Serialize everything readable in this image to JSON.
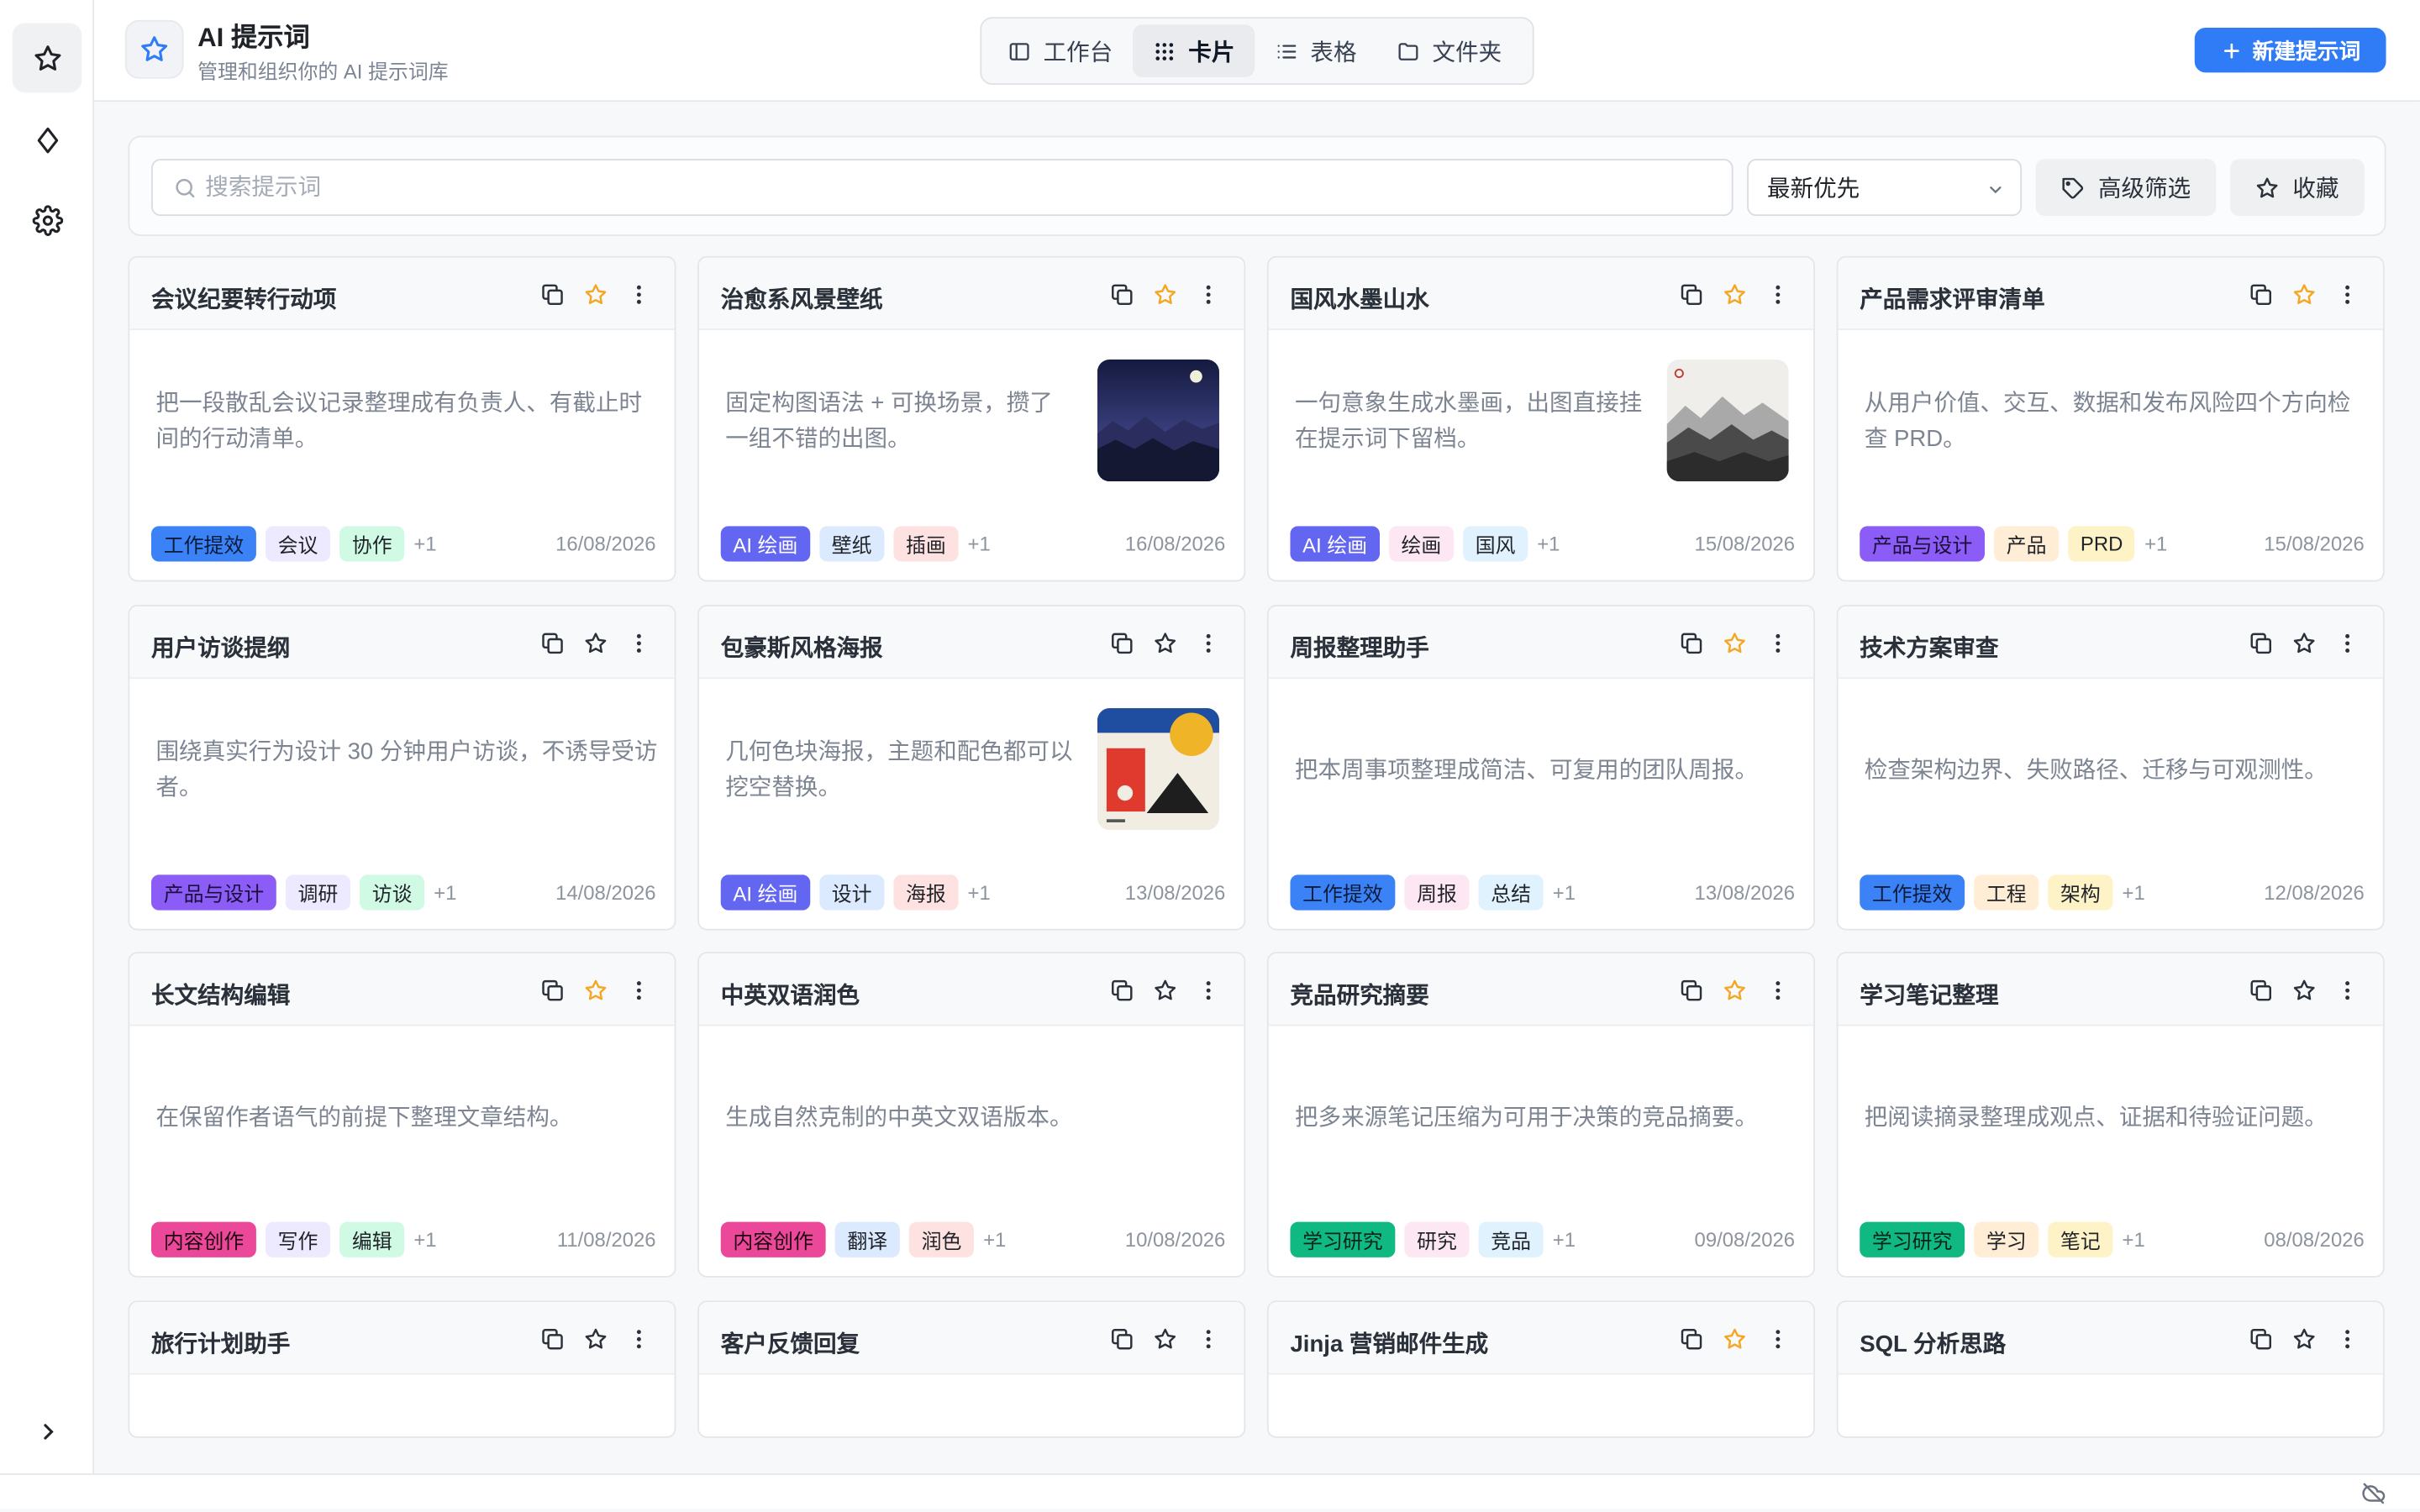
{
  "header": {
    "title": "AI 提示词",
    "subtitle": "管理和组织你的 AI 提示词库",
    "views": [
      "工作台",
      "卡片",
      "表格",
      "文件夹"
    ],
    "active_view": "卡片",
    "new_button": "新建提示词"
  },
  "filters": {
    "search_placeholder": "搜索提示词",
    "sort": "最新优先",
    "advanced": "高级筛选",
    "favorites": "收藏"
  },
  "colors": {
    "accent": "#2f7cf6",
    "star_active": "#f5a623"
  },
  "cards": [
    {
      "title": "会议纪要转行动项",
      "desc": "把一段散乱会议记录整理成有负责人、有截止时间的行动清单。",
      "starred": true,
      "image": "",
      "tags": [
        "工作提效",
        "会议",
        "协作"
      ],
      "more": "+1",
      "date": "16/08/2026"
    },
    {
      "title": "治愈系风景壁纸",
      "desc": "固定构图语法 + 可换场景，攒了一组不错的出图。",
      "starred": true,
      "image": "night-landscape",
      "tags": [
        "AI 绘画",
        "壁纸",
        "插画"
      ],
      "more": "+1",
      "date": "16/08/2026"
    },
    {
      "title": "国风水墨山水",
      "desc": "一句意象生成水墨画，出图直接挂在提示词下留档。",
      "starred": true,
      "image": "ink-mountains",
      "tags": [
        "AI 绘画",
        "绘画",
        "国风"
      ],
      "more": "+1",
      "date": "15/08/2026"
    },
    {
      "title": "产品需求评审清单",
      "desc": "从用户价值、交互、数据和发布风险四个方向检查 PRD。",
      "starred": true,
      "image": "",
      "tags": [
        "产品与设计",
        "产品",
        "PRD"
      ],
      "more": "+1",
      "date": "15/08/2026"
    },
    {
      "title": "用户访谈提纲",
      "desc": "围绕真实行为设计 30 分钟用户访谈，不诱导受访者。",
      "starred": false,
      "image": "",
      "tags": [
        "产品与设计",
        "调研",
        "访谈"
      ],
      "more": "+1",
      "date": "14/08/2026"
    },
    {
      "title": "包豪斯风格海报",
      "desc": "几何色块海报，主题和配色都可以挖空替换。",
      "starred": false,
      "image": "bauhaus-poster",
      "tags": [
        "AI 绘画",
        "设计",
        "海报"
      ],
      "more": "+1",
      "date": "13/08/2026"
    },
    {
      "title": "周报整理助手",
      "desc": "把本周事项整理成简洁、可复用的团队周报。",
      "starred": true,
      "image": "",
      "tags": [
        "工作提效",
        "周报",
        "总结"
      ],
      "more": "+1",
      "date": "13/08/2026"
    },
    {
      "title": "技术方案审查",
      "desc": "检查架构边界、失败路径、迁移与可观测性。",
      "starred": false,
      "image": "",
      "tags": [
        "工作提效",
        "工程",
        "架构"
      ],
      "more": "+1",
      "date": "12/08/2026"
    },
    {
      "title": "长文结构编辑",
      "desc": "在保留作者语气的前提下整理文章结构。",
      "starred": true,
      "image": "",
      "tags": [
        "内容创作",
        "写作",
        "编辑"
      ],
      "more": "+1",
      "date": "11/08/2026"
    },
    {
      "title": "中英双语润色",
      "desc": "生成自然克制的中英文双语版本。",
      "starred": false,
      "image": "",
      "tags": [
        "内容创作",
        "翻译",
        "润色"
      ],
      "more": "+1",
      "date": "10/08/2026"
    },
    {
      "title": "竞品研究摘要",
      "desc": "把多来源笔记压缩为可用于决策的竞品摘要。",
      "starred": true,
      "image": "",
      "tags": [
        "学习研究",
        "研究",
        "竞品"
      ],
      "more": "+1",
      "date": "09/08/2026"
    },
    {
      "title": "学习笔记整理",
      "desc": "把阅读摘录整理成观点、证据和待验证问题。",
      "starred": false,
      "image": "",
      "tags": [
        "学习研究",
        "学习",
        "笔记"
      ],
      "more": "+1",
      "date": "08/08/2026"
    },
    {
      "title": "旅行计划助手",
      "desc": "",
      "starred": false,
      "image": "",
      "tags": [],
      "more": "",
      "date": ""
    },
    {
      "title": "客户反馈回复",
      "desc": "",
      "starred": false,
      "image": "",
      "tags": [],
      "more": "",
      "date": ""
    },
    {
      "title": "Jinja 营销邮件生成",
      "desc": "",
      "starred": true,
      "image": "",
      "tags": [],
      "more": "",
      "date": ""
    },
    {
      "title": "SQL 分析思路",
      "desc": "",
      "starred": false,
      "image": "",
      "tags": [],
      "more": "",
      "date": ""
    }
  ]
}
